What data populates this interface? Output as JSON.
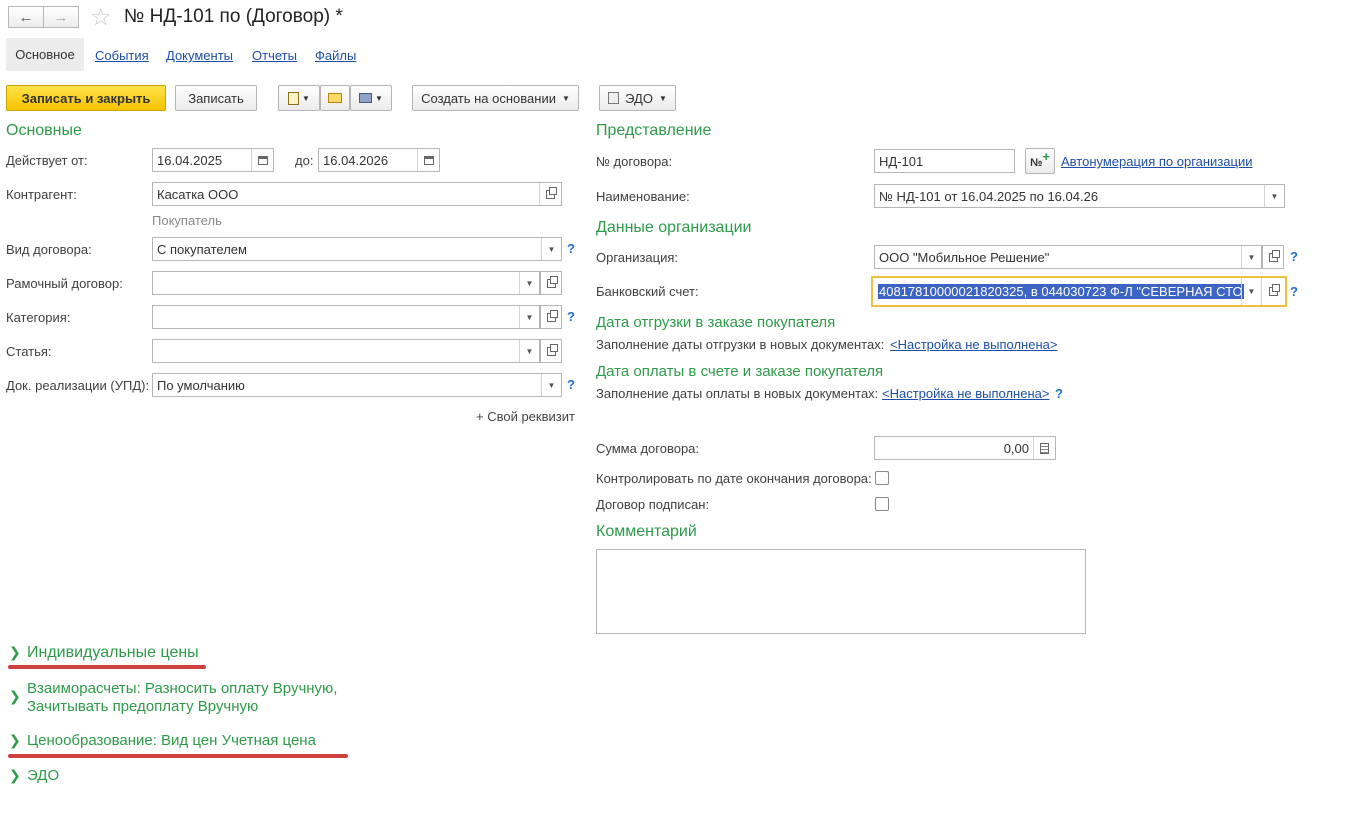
{
  "window": {
    "title": "№ НД-101 по (Договор) *"
  },
  "tabs": [
    "Основное",
    "События",
    "Документы",
    "Отчеты",
    "Файлы"
  ],
  "toolbar": {
    "save_close": "Записать и закрыть",
    "save": "Записать",
    "create_based": "Создать на основании",
    "edo": "ЭДО"
  },
  "main": {
    "section_title": "Основные",
    "valid_from_label": "Действует от:",
    "valid_from": "16.04.2025",
    "valid_to_label": "до:",
    "valid_to": "16.04.2026",
    "counterparty_label": "Контрагент:",
    "counterparty": "Касатка ООО",
    "counterparty_role": "Покупатель",
    "contract_type_label": "Вид договора:",
    "contract_type": "С покупателем",
    "frame_contract_label": "Рамочный договор:",
    "frame_contract": "",
    "category_label": "Категория:",
    "category": "",
    "article_label": "Статья:",
    "article": "",
    "realization_doc_label": "Док. реализации (УПД):",
    "realization_doc": "По умолчанию",
    "custom_attr": "+ Свой реквизит"
  },
  "right": {
    "representation_title": "Представление",
    "contract_no_label": "№ договора:",
    "contract_no": "НД-101",
    "autonum_link": "Автонумерация по организации",
    "name_label": "Наименование:",
    "name": "№ НД-101 от 16.04.2025 по 16.04.26",
    "org_data_title": "Данные организации",
    "org_label": "Организация:",
    "org": "ООО \"Мобильное Решение\"",
    "bank_label": "Банковский счет:",
    "bank": "40817810000021820325, в 044030723 Ф-Л \"СЕВЕРНАЯ СТО",
    "ship_title": "Дата отгрузки в заказе покупателя",
    "ship_fill_label": "Заполнение даты отгрузки в новых документах:",
    "ship_fill_link": "<Настройка не выполнена>",
    "pay_title": "Дата оплаты в счете и заказе покупателя",
    "pay_fill_label": "Заполнение даты оплаты в новых документах:",
    "pay_fill_link": "<Настройка не выполнена>",
    "amount_label": "Сумма договора:",
    "amount": "0,00",
    "control_end_label": "Контролировать по дате окончания договора:",
    "signed_label": "Договор подписан:",
    "comment_title": "Комментарий",
    "comment": ""
  },
  "groups": {
    "individual_prices": "Индивидуальные цены",
    "settlements_line1": "Взаиморасчеты: Разносить оплату Вручную,",
    "settlements_line2": "Зачитывать предоплату Вручную",
    "pricing": "Ценообразование: Вид цен Учетная цена",
    "edo": "ЭДО"
  },
  "colors": {
    "accent_green": "#2e9b4a",
    "link_blue": "#1f4fa8",
    "primary_yellow": "#f5c400",
    "highlight_red": "#d04040",
    "selection_blue": "#3d63c4"
  }
}
